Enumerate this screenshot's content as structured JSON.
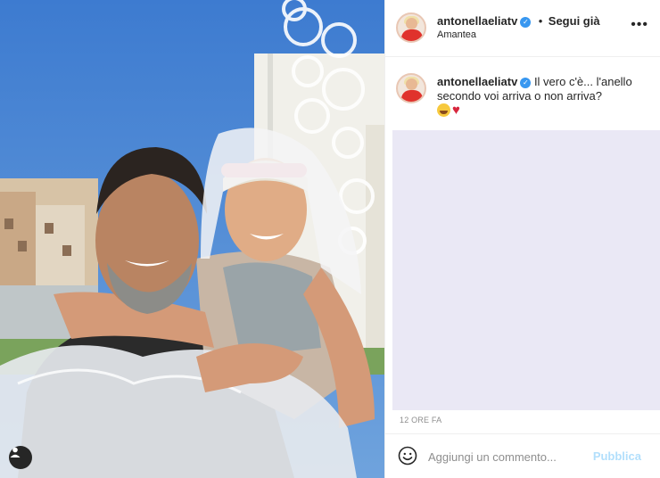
{
  "post": {
    "username": "antonellaeliatv",
    "follow_separator": "•",
    "follow_label": "Segui già",
    "location": "Amantea",
    "more_icon": "more-horizontal-icon",
    "verified_icon": "verified-badge-icon"
  },
  "caption": {
    "username": "antonellaeliatv",
    "text": "Il vero c'è... l'anello secondo voi arriva o non arriva?",
    "emojis": [
      "rolling-on-floor-laughing-emoji",
      "red-heart-emoji"
    ]
  },
  "timestamp": "12 ORE FA",
  "comment": {
    "placeholder": "Aggiungi un commento...",
    "publish_label": "Pubblica",
    "emoji_icon": "smiley-icon"
  },
  "photo": {
    "tag_icon": "user-tag-icon"
  },
  "colors": {
    "publish_disabled": "#b2dffc",
    "verified": "#3897f0",
    "ad_block": "#eae8f5",
    "sky": "#3f7fd0"
  }
}
